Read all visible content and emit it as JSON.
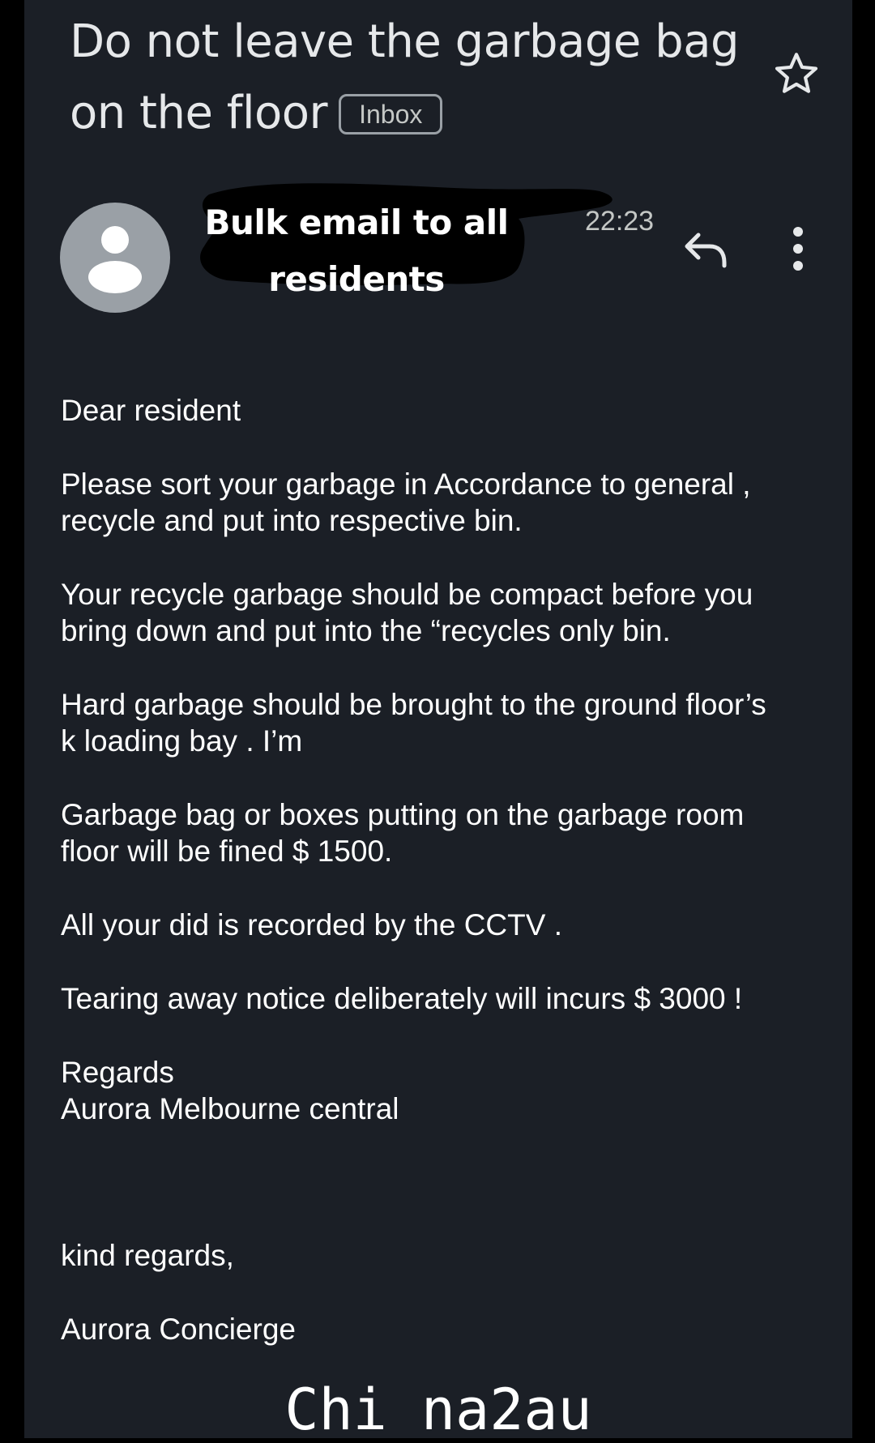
{
  "email": {
    "subject": "Do not leave the garbage bag on the floor",
    "label": "Inbox",
    "sender": "Bulk email to all residents",
    "time": "22:23"
  },
  "icons": {
    "star": "star-outline-icon",
    "avatar": "person-avatar-icon",
    "reply": "reply-arrow-icon",
    "more": "more-vertical-icon"
  },
  "body": {
    "greeting": "Dear resident",
    "p1": "Please sort your garbage in Accordance to general ,\nrecycle and put into respective bin.",
    "p2": "Your recycle garbage should be compact before you\nbring down and put into the “recycles only bin.",
    "p3": "Hard garbage should be brought to the ground floor’s\nk loading bay . I’m",
    "p4": "Garbage bag or boxes putting on the garbage room\nfloor will be fined $ 1500.",
    "p5": "All your did is recorded by the CCTV .",
    "p6": "Tearing away notice deliberately will incurs $ 3000 !",
    "regards": "Regards\nAurora Melbourne central",
    "kind_regards": "kind regards,",
    "signature": "Aurora Concierge"
  },
  "watermark": "Chi na2au",
  "colors": {
    "background": "#1b1f26",
    "text": "#ffffff",
    "muted": "#c4c7c5",
    "avatar": "#9aa0a6"
  }
}
